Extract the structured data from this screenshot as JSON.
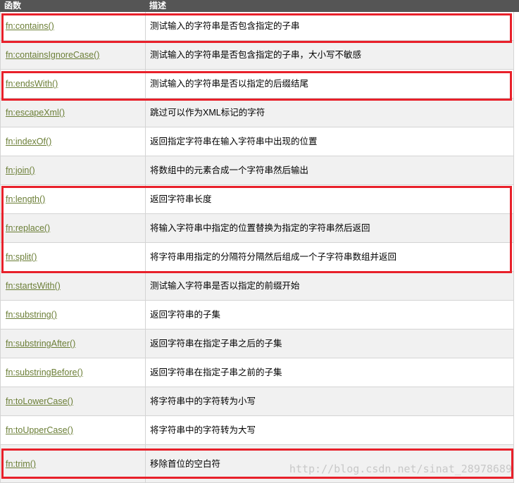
{
  "header": {
    "col_function": "函数",
    "col_description": "描述"
  },
  "rows": [
    {
      "fn": "fn:contains()",
      "desc": "测试输入的字符串是否包含指定的子串"
    },
    {
      "fn": "fn:containsIgnoreCase()",
      "desc": "测试输入的字符串是否包含指定的子串，大小写不敏感"
    },
    {
      "fn": "fn:endsWith()",
      "desc": "测试输入的字符串是否以指定的后缀结尾"
    },
    {
      "fn": "fn:escapeXml()",
      "desc": "跳过可以作为XML标记的字符"
    },
    {
      "fn": "fn:indexOf()",
      "desc": "返回指定字符串在输入字符串中出现的位置"
    },
    {
      "fn": "fn:join()",
      "desc": "将数组中的元素合成一个字符串然后输出"
    },
    {
      "fn": "fn:length()",
      "desc": "返回字符串长度"
    },
    {
      "fn": "fn:replace()",
      "desc": "将输入字符串中指定的位置替换为指定的字符串然后返回"
    },
    {
      "fn": "fn:split()",
      "desc": "将字符串用指定的分隔符分隔然后组成一个子字符串数组并返回"
    },
    {
      "fn": "fn:startsWith()",
      "desc": "测试输入字符串是否以指定的前缀开始"
    },
    {
      "fn": "fn:substring()",
      "desc": "返回字符串的子集"
    },
    {
      "fn": "fn:substringAfter()",
      "desc": "返回字符串在指定子串之后的子集"
    },
    {
      "fn": "fn:substringBefore()",
      "desc": "返回字符串在指定子串之前的子集"
    },
    {
      "fn": "fn:toLowerCase()",
      "desc": "将字符串中的字符转为小写"
    },
    {
      "fn": "fn:toUpperCase()",
      "desc": "将字符串中的字符转为大写"
    },
    {
      "fn": "fn:trim()",
      "desc": "移除首位的空白符"
    }
  ],
  "watermark": "http://blog.csdn.net/sinat_28978689",
  "colors": {
    "header_bg": "#555555",
    "link": "#6b7e36",
    "highlight": "#e8202a"
  }
}
